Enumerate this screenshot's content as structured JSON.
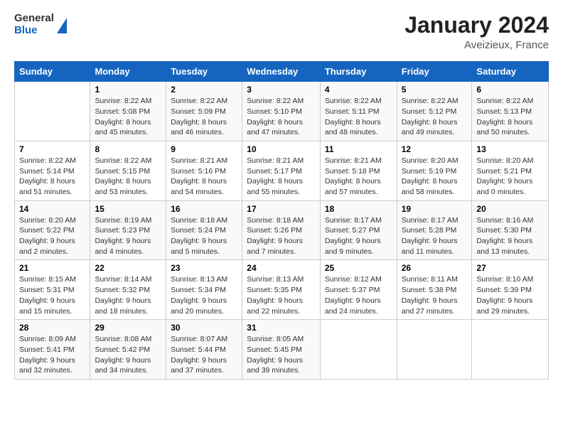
{
  "logo": {
    "line1": "General",
    "line2": "Blue"
  },
  "title": "January 2024",
  "subtitle": "Aveizieux, France",
  "days_of_week": [
    "Sunday",
    "Monday",
    "Tuesday",
    "Wednesday",
    "Thursday",
    "Friday",
    "Saturday"
  ],
  "weeks": [
    [
      {
        "num": "",
        "sunrise": "",
        "sunset": "",
        "daylight": ""
      },
      {
        "num": "1",
        "sunrise": "Sunrise: 8:22 AM",
        "sunset": "Sunset: 5:08 PM",
        "daylight": "Daylight: 8 hours and 45 minutes."
      },
      {
        "num": "2",
        "sunrise": "Sunrise: 8:22 AM",
        "sunset": "Sunset: 5:09 PM",
        "daylight": "Daylight: 8 hours and 46 minutes."
      },
      {
        "num": "3",
        "sunrise": "Sunrise: 8:22 AM",
        "sunset": "Sunset: 5:10 PM",
        "daylight": "Daylight: 8 hours and 47 minutes."
      },
      {
        "num": "4",
        "sunrise": "Sunrise: 8:22 AM",
        "sunset": "Sunset: 5:11 PM",
        "daylight": "Daylight: 8 hours and 48 minutes."
      },
      {
        "num": "5",
        "sunrise": "Sunrise: 8:22 AM",
        "sunset": "Sunset: 5:12 PM",
        "daylight": "Daylight: 8 hours and 49 minutes."
      },
      {
        "num": "6",
        "sunrise": "Sunrise: 8:22 AM",
        "sunset": "Sunset: 5:13 PM",
        "daylight": "Daylight: 8 hours and 50 minutes."
      }
    ],
    [
      {
        "num": "7",
        "sunrise": "Sunrise: 8:22 AM",
        "sunset": "Sunset: 5:14 PM",
        "daylight": "Daylight: 8 hours and 51 minutes."
      },
      {
        "num": "8",
        "sunrise": "Sunrise: 8:22 AM",
        "sunset": "Sunset: 5:15 PM",
        "daylight": "Daylight: 8 hours and 53 minutes."
      },
      {
        "num": "9",
        "sunrise": "Sunrise: 8:21 AM",
        "sunset": "Sunset: 5:16 PM",
        "daylight": "Daylight: 8 hours and 54 minutes."
      },
      {
        "num": "10",
        "sunrise": "Sunrise: 8:21 AM",
        "sunset": "Sunset: 5:17 PM",
        "daylight": "Daylight: 8 hours and 55 minutes."
      },
      {
        "num": "11",
        "sunrise": "Sunrise: 8:21 AM",
        "sunset": "Sunset: 5:18 PM",
        "daylight": "Daylight: 8 hours and 57 minutes."
      },
      {
        "num": "12",
        "sunrise": "Sunrise: 8:20 AM",
        "sunset": "Sunset: 5:19 PM",
        "daylight": "Daylight: 8 hours and 58 minutes."
      },
      {
        "num": "13",
        "sunrise": "Sunrise: 8:20 AM",
        "sunset": "Sunset: 5:21 PM",
        "daylight": "Daylight: 9 hours and 0 minutes."
      }
    ],
    [
      {
        "num": "14",
        "sunrise": "Sunrise: 8:20 AM",
        "sunset": "Sunset: 5:22 PM",
        "daylight": "Daylight: 9 hours and 2 minutes."
      },
      {
        "num": "15",
        "sunrise": "Sunrise: 8:19 AM",
        "sunset": "Sunset: 5:23 PM",
        "daylight": "Daylight: 9 hours and 4 minutes."
      },
      {
        "num": "16",
        "sunrise": "Sunrise: 8:18 AM",
        "sunset": "Sunset: 5:24 PM",
        "daylight": "Daylight: 9 hours and 5 minutes."
      },
      {
        "num": "17",
        "sunrise": "Sunrise: 8:18 AM",
        "sunset": "Sunset: 5:26 PM",
        "daylight": "Daylight: 9 hours and 7 minutes."
      },
      {
        "num": "18",
        "sunrise": "Sunrise: 8:17 AM",
        "sunset": "Sunset: 5:27 PM",
        "daylight": "Daylight: 9 hours and 9 minutes."
      },
      {
        "num": "19",
        "sunrise": "Sunrise: 8:17 AM",
        "sunset": "Sunset: 5:28 PM",
        "daylight": "Daylight: 9 hours and 11 minutes."
      },
      {
        "num": "20",
        "sunrise": "Sunrise: 8:16 AM",
        "sunset": "Sunset: 5:30 PM",
        "daylight": "Daylight: 9 hours and 13 minutes."
      }
    ],
    [
      {
        "num": "21",
        "sunrise": "Sunrise: 8:15 AM",
        "sunset": "Sunset: 5:31 PM",
        "daylight": "Daylight: 9 hours and 15 minutes."
      },
      {
        "num": "22",
        "sunrise": "Sunrise: 8:14 AM",
        "sunset": "Sunset: 5:32 PM",
        "daylight": "Daylight: 9 hours and 18 minutes."
      },
      {
        "num": "23",
        "sunrise": "Sunrise: 8:13 AM",
        "sunset": "Sunset: 5:34 PM",
        "daylight": "Daylight: 9 hours and 20 minutes."
      },
      {
        "num": "24",
        "sunrise": "Sunrise: 8:13 AM",
        "sunset": "Sunset: 5:35 PM",
        "daylight": "Daylight: 9 hours and 22 minutes."
      },
      {
        "num": "25",
        "sunrise": "Sunrise: 8:12 AM",
        "sunset": "Sunset: 5:37 PM",
        "daylight": "Daylight: 9 hours and 24 minutes."
      },
      {
        "num": "26",
        "sunrise": "Sunrise: 8:11 AM",
        "sunset": "Sunset: 5:38 PM",
        "daylight": "Daylight: 9 hours and 27 minutes."
      },
      {
        "num": "27",
        "sunrise": "Sunrise: 8:10 AM",
        "sunset": "Sunset: 5:39 PM",
        "daylight": "Daylight: 9 hours and 29 minutes."
      }
    ],
    [
      {
        "num": "28",
        "sunrise": "Sunrise: 8:09 AM",
        "sunset": "Sunset: 5:41 PM",
        "daylight": "Daylight: 9 hours and 32 minutes."
      },
      {
        "num": "29",
        "sunrise": "Sunrise: 8:08 AM",
        "sunset": "Sunset: 5:42 PM",
        "daylight": "Daylight: 9 hours and 34 minutes."
      },
      {
        "num": "30",
        "sunrise": "Sunrise: 8:07 AM",
        "sunset": "Sunset: 5:44 PM",
        "daylight": "Daylight: 9 hours and 37 minutes."
      },
      {
        "num": "31",
        "sunrise": "Sunrise: 8:05 AM",
        "sunset": "Sunset: 5:45 PM",
        "daylight": "Daylight: 9 hours and 39 minutes."
      },
      {
        "num": "",
        "sunrise": "",
        "sunset": "",
        "daylight": ""
      },
      {
        "num": "",
        "sunrise": "",
        "sunset": "",
        "daylight": ""
      },
      {
        "num": "",
        "sunrise": "",
        "sunset": "",
        "daylight": ""
      }
    ]
  ]
}
